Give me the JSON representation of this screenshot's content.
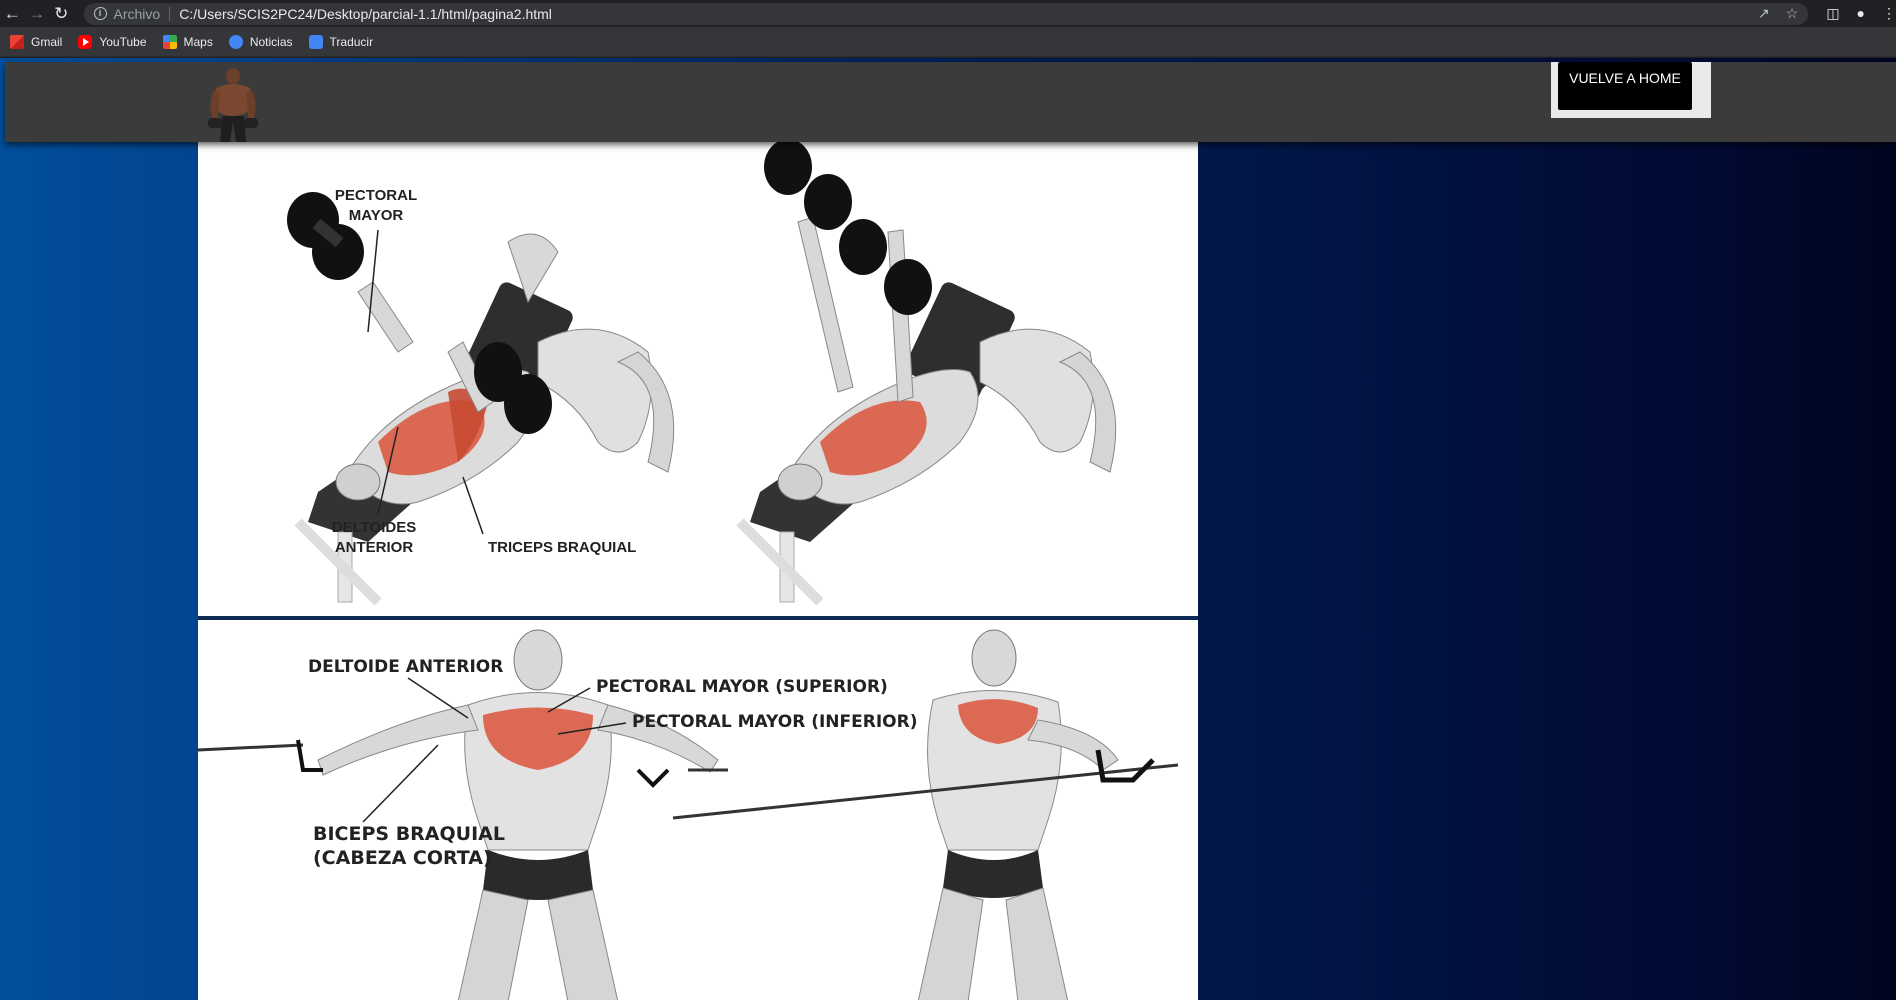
{
  "browser": {
    "address": {
      "security_label": "Archivo",
      "url": "C:/Users/SCIS2PC24/Desktop/parcial-1.1/html/pagina2.html"
    },
    "bookmarks": [
      {
        "label": "Gmail",
        "icon": "gmail-icon"
      },
      {
        "label": "YouTube",
        "icon": "youtube-icon"
      },
      {
        "label": "Maps",
        "icon": "maps-icon"
      },
      {
        "label": "Noticias",
        "icon": "news-icon"
      },
      {
        "label": "Traducir",
        "icon": "translate-icon"
      }
    ]
  },
  "header": {
    "home_button": "VUELVE A HOME"
  },
  "figure1": {
    "labels": {
      "pectoral_1": "PECTORAL",
      "pectoral_2": "MAYOR",
      "deltoides_1": "DELTOIDES",
      "deltoides_2": "ANTERIOR",
      "triceps": "TRICEPS BRAQUIAL"
    }
  },
  "figure2": {
    "labels": {
      "deltoide": "DELTOIDE ANTERIOR",
      "pec_sup": "PECTORAL MAYOR (SUPERIOR)",
      "pec_inf": "PECTORAL MAYOR (INFERIOR)",
      "biceps_1": "BICEPS BRAQUIAL",
      "biceps_2": "(CABEZA CORTA)"
    }
  },
  "colors": {
    "muscle": "#d9533a",
    "page_gradient_left": "#024f9d",
    "page_gradient_right": "#000520",
    "header": "#3b3b3b"
  }
}
